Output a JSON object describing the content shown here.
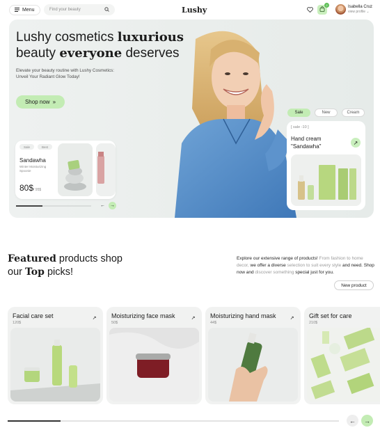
{
  "header": {
    "menu_label": "Menu",
    "menu_icon": "hamburger-icon",
    "search_placeholder": "Find your beauty",
    "logo": "Lushy",
    "cart_count": "2",
    "user_name": "Isabella Cruz",
    "user_link": "view profile"
  },
  "hero": {
    "title_1": "Lushy cosmetics ",
    "title_bold_1": "luxurious",
    "title_2": "beauty ",
    "title_bold_2": "everyone",
    "title_3": " deserves",
    "subtitle": "Elevate your beauty routine with Lushy Cosmetics: Unveil Your Radiant Glow Today!",
    "shop_button": "Shop now",
    "shop_arrow": "»",
    "left_card": {
      "chip_1": "Sale",
      "chip_2": "Best",
      "name": "Sandawha",
      "desc": "Winter Moisturizing Spoonie",
      "price": "80$",
      "old_price": "/ 95$",
      "product_label": "Sandawha"
    },
    "tabs": [
      "Sale",
      "New",
      "Cream"
    ],
    "right_card": {
      "tag": "[ sale -10 ]",
      "title": "Hand cream \"Sandawha\""
    }
  },
  "featured": {
    "title_bold_1": "Featured",
    "title_1": " products shop",
    "title_2": "our ",
    "title_bold_2": "Top",
    "title_3": " picks!",
    "desc_1": "Explore our extensive range of products! ",
    "desc_2": "From fashion to home decor,",
    "desc_3": " we offer a diverse ",
    "desc_4": "selection to suit every style",
    "desc_5": " and need. Shop now and ",
    "desc_6": "discover something",
    "desc_7": " special just for you.",
    "new_product_button": "New product"
  },
  "products": [
    {
      "name": "Facial care set",
      "price": "120$"
    },
    {
      "name": "Moisturizing face mask",
      "price": "50$"
    },
    {
      "name": "Moisturizing hand mask",
      "price": "44$"
    },
    {
      "name": "Gift set for care",
      "price": "210$"
    }
  ],
  "colors": {
    "accent_green": "#c3ecb4",
    "product_green": "#a9d07e",
    "mask_red": "#7e1d25"
  },
  "arrows": {
    "prev": "←",
    "next": "→",
    "diag": "↗"
  }
}
